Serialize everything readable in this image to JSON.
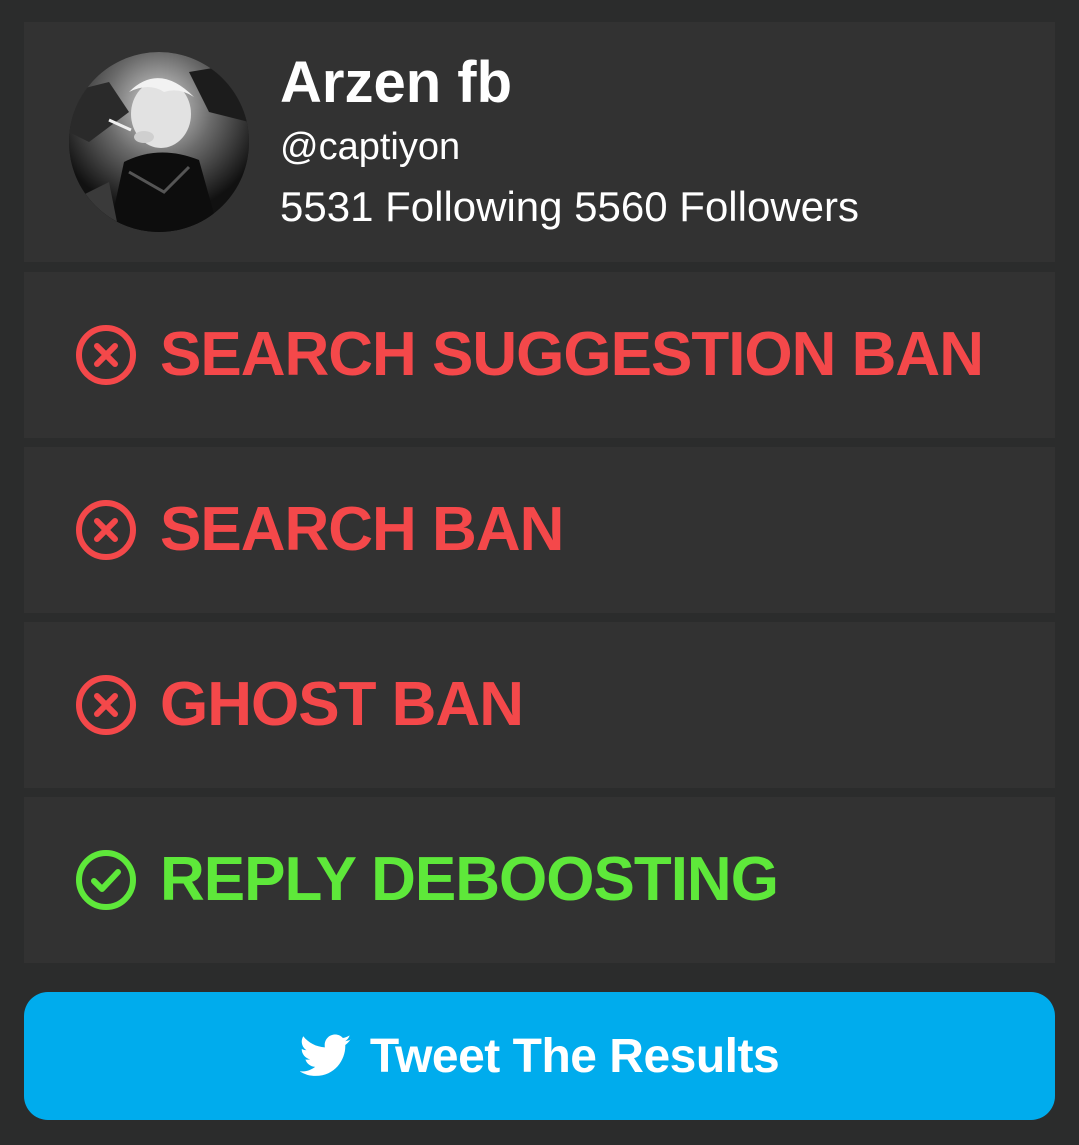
{
  "colors": {
    "background": "#2b2c2c",
    "card": "#323232",
    "banned": "#f4484a",
    "clear": "#5ee83a",
    "button": "#00aced",
    "text": "#ffffff"
  },
  "profile": {
    "name": "Arzen fb",
    "handle": "@captiyon",
    "stats": "5531 Following 5560 Followers",
    "avatar_icon": "profile-photo"
  },
  "results": [
    {
      "label": "SEARCH SUGGESTION BAN",
      "status": "banned",
      "icon": "x-circle-icon"
    },
    {
      "label": "SEARCH BAN",
      "status": "banned",
      "icon": "x-circle-icon"
    },
    {
      "label": "GHOST BAN",
      "status": "banned",
      "icon": "x-circle-icon"
    },
    {
      "label": "REPLY DEBOOSTING",
      "status": "clear",
      "icon": "check-circle-icon"
    }
  ],
  "tweet_button": {
    "label": "Tweet The Results",
    "icon": "twitter-bird-icon"
  }
}
